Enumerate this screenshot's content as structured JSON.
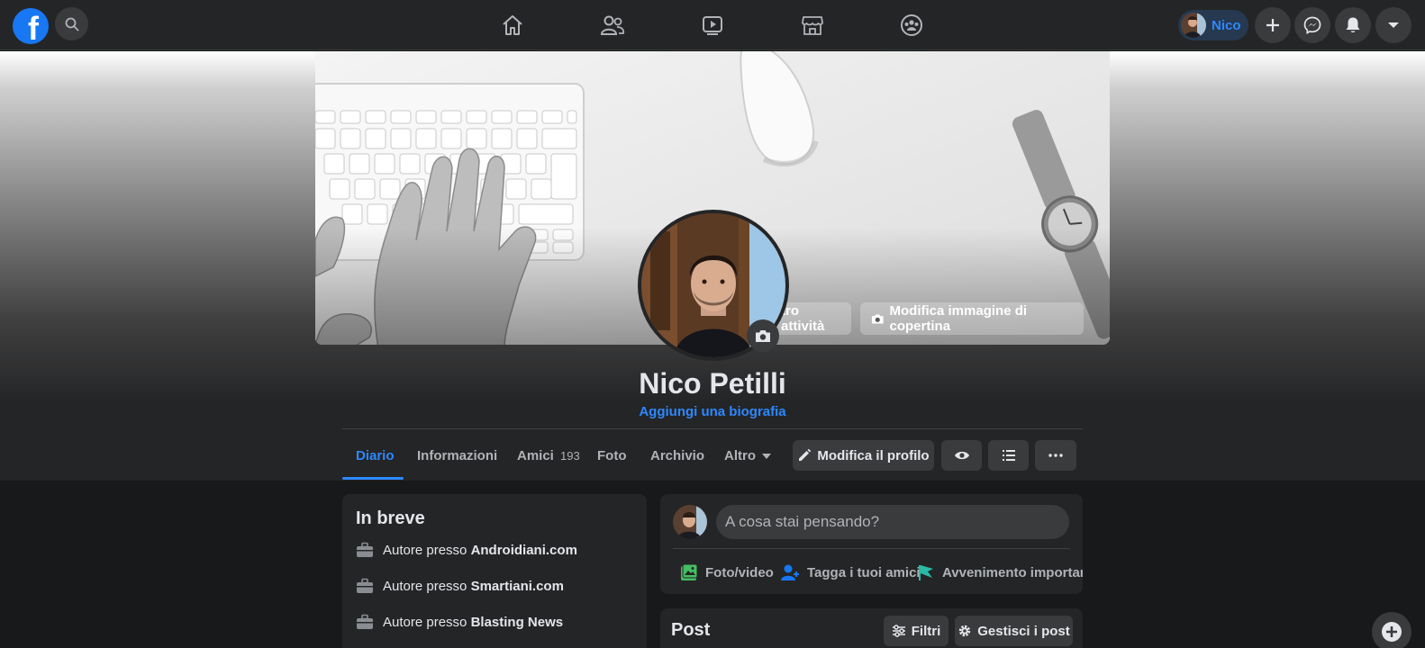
{
  "topbar": {
    "logo_letter": "f",
    "profile_chip_label": "Nico"
  },
  "cover": {
    "activity_button_label": "tro attività",
    "edit_cover_label": "Modifica immagine di copertina"
  },
  "profile": {
    "name": "Nico Petilli",
    "bio_link": "Aggiungi una biografia"
  },
  "tabs": [
    {
      "label": "Diario",
      "active": true
    },
    {
      "label": "Informazioni"
    },
    {
      "label": "Amici",
      "count": "193"
    },
    {
      "label": "Foto"
    },
    {
      "label": "Archivio"
    },
    {
      "label": "Altro"
    }
  ],
  "header_actions": {
    "edit_profile_label": "Modifica il profilo"
  },
  "intro": {
    "title": "In breve",
    "items": [
      {
        "prefix": "Autore presso ",
        "org": "Androidiani.com"
      },
      {
        "prefix": "Autore presso ",
        "org": "Smartiani.com"
      },
      {
        "prefix": "Autore presso ",
        "org": "Blasting News"
      }
    ]
  },
  "composer": {
    "placeholder": "A cosa stai pensando?",
    "actions": [
      {
        "label": "Foto/video"
      },
      {
        "label": "Tagga i tuoi amici"
      },
      {
        "label": "Avvenimento importante"
      }
    ]
  },
  "posts": {
    "title": "Post",
    "filters_label": "Filtri",
    "manage_label": "Gestisci i post"
  },
  "colors": {
    "accent": "#2d88ff",
    "topbar": "#242526",
    "background": "#18191a",
    "surface": "#3a3b3c"
  }
}
